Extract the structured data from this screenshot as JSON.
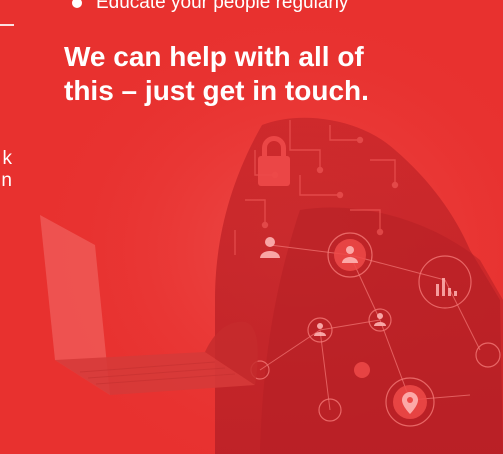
{
  "bullets": [
    {
      "text": "Educate your people regularly"
    }
  ],
  "headline": {
    "line1": "We can help with all of",
    "line2": "this – just get in touch."
  },
  "left_fragment": {
    "line1": "k",
    "line2": "n"
  },
  "icons": [
    "padlock-icon",
    "user-icon",
    "bar-chart-icon",
    "location-pin-icon",
    "laptop-icon"
  ],
  "colors": {
    "background": "#e8312f",
    "text": "#ffffff"
  }
}
